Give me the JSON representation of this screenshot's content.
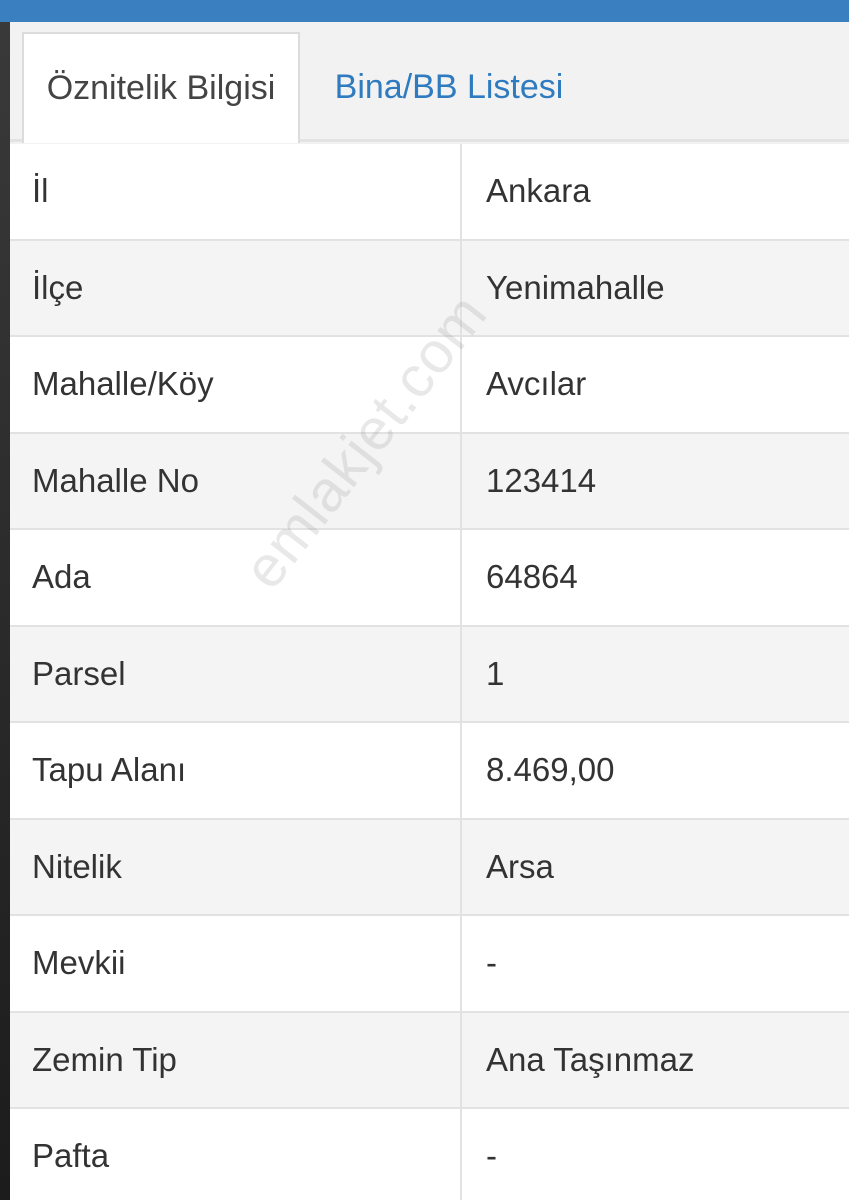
{
  "tabs": [
    {
      "label": "Öznitelik Bilgisi",
      "active": true
    },
    {
      "label": "Bina/BB Listesi",
      "active": false
    }
  ],
  "attributes": [
    {
      "label": "İl",
      "value": "Ankara"
    },
    {
      "label": "İlçe",
      "value": "Yenimahalle"
    },
    {
      "label": "Mahalle/Köy",
      "value": "Avcılar"
    },
    {
      "label": "Mahalle No",
      "value": "123414"
    },
    {
      "label": "Ada",
      "value": "64864"
    },
    {
      "label": "Parsel",
      "value": "1"
    },
    {
      "label": "Tapu Alanı",
      "value": "8.469,00"
    },
    {
      "label": "Nitelik",
      "value": "Arsa"
    },
    {
      "label": "Mevkii",
      "value": "-"
    },
    {
      "label": "Zemin Tip",
      "value": "Ana Taşınmaz"
    },
    {
      "label": "Pafta",
      "value": "-"
    }
  ],
  "watermark": "emlakjet.com",
  "colors": {
    "accent": "#3a7fc0",
    "link": "#2f7bbf",
    "text": "#333333"
  }
}
